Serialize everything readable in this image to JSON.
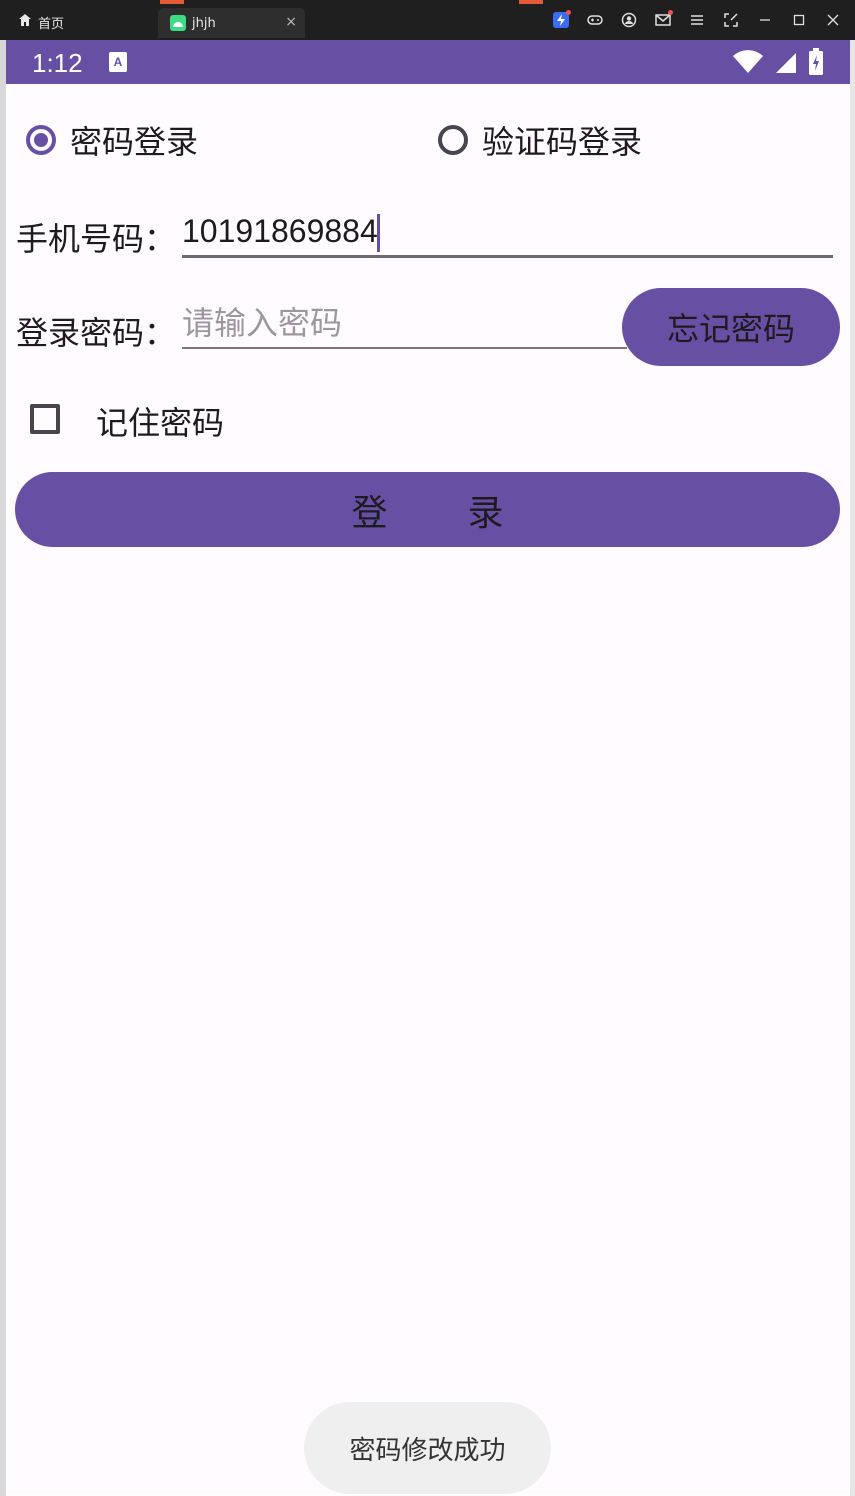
{
  "host": {
    "home_tab_label": "首页",
    "active_tab_label": "jhjh",
    "close_glyph": "×",
    "icons": [
      "bolt-icon",
      "gamepad-icon",
      "account-icon",
      "mail-icon",
      "menu-icon",
      "screenshot-icon",
      "minimize-icon",
      "maximize-icon",
      "window-close-icon"
    ]
  },
  "status_bar": {
    "time": "1:12",
    "a_badge": "A",
    "icons": [
      "wifi-icon",
      "signal-icon",
      "battery-icon"
    ]
  },
  "login_mode": {
    "options": [
      {
        "label": "密码登录",
        "checked": true
      },
      {
        "label": "验证码登录",
        "checked": false
      }
    ]
  },
  "phone": {
    "label": "手机号码：",
    "value": "10191869884"
  },
  "password": {
    "label": "登录密码：",
    "placeholder": "请输入密码",
    "forgot_button": "忘记密码"
  },
  "remember": {
    "label": "记住密码",
    "checked": false
  },
  "login_button": {
    "label": "登录"
  },
  "toast": {
    "message": "密码修改成功"
  },
  "colors": {
    "primary": "#6750a4",
    "background": "#fffbfe",
    "on_surface": "#1c1b1f",
    "outline": "#49454f",
    "toast_bg": "#efefef"
  }
}
